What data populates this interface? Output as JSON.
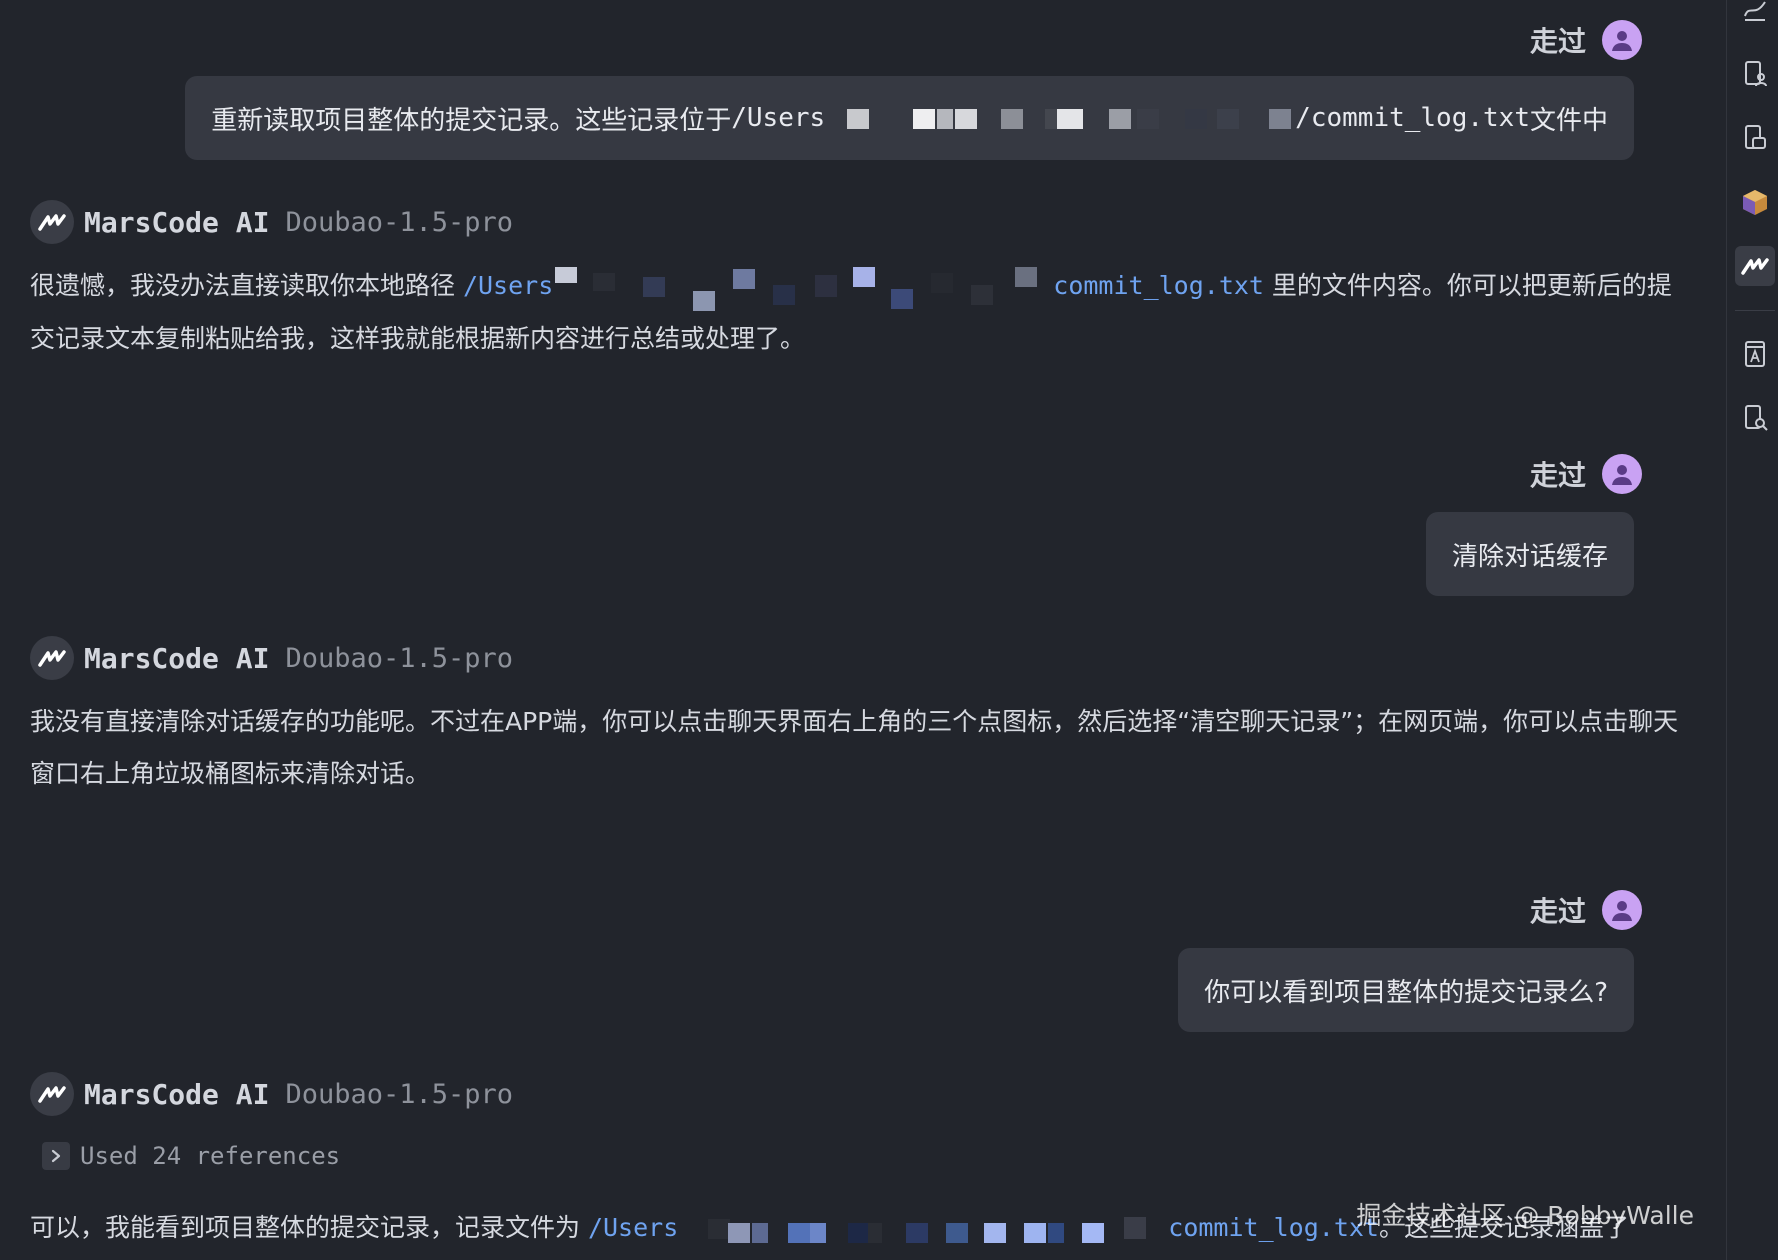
{
  "messages": [
    {
      "role": "user",
      "author": "走过",
      "text_before": "重新读取项目整体的提交记录。这些记录位于 ",
      "path_start": "/Users",
      "path_end": "/commit_log.txt",
      "text_after": " 文件中"
    },
    {
      "role": "ai",
      "author": "MarsCode AI",
      "model": "Doubao-1.5-pro",
      "text_before": "很遗憾，我没办法直接读取你本地路径 ",
      "path_start": "/Users",
      "path_end": "commit_log.txt",
      "text_after": " 里的文件内容。你可以把更新后的提交记录文本复制粘贴给我，这样我就能根据新内容进行总结或处理了。"
    },
    {
      "role": "user",
      "author": "走过",
      "text": "清除对话缓存"
    },
    {
      "role": "ai",
      "author": "MarsCode AI",
      "model": "Doubao-1.5-pro",
      "text": "我没有直接清除对话缓存的功能呢。不过在APP端，你可以点击聊天界面右上角的三个点图标，然后选择“清空聊天记录”；在网页端，你可以点击聊天窗口右上角垃圾桶图标来清除对话。"
    },
    {
      "role": "user",
      "author": "走过",
      "text": "你可以看到项目整体的提交记录么?"
    },
    {
      "role": "ai",
      "author": "MarsCode AI",
      "model": "Doubao-1.5-pro",
      "references_label": "Used 24 references",
      "text_before": "可以，我能看到项目整体的提交记录，记录文件为 ",
      "path_start": "/Users",
      "path_end": "commit_log.txt",
      "text_after": "。这些提交记录涵盖了"
    }
  ],
  "watermark": "掘金技术社区 @ BobbyWalle",
  "sidebar_icons": [
    "trend-icon",
    "file-user-icon",
    "file-copy-icon",
    "cube-icon",
    "marscode-icon",
    "dictionary-icon",
    "file-search-icon"
  ],
  "colors": {
    "background": "#22252c",
    "bubble": "#363942",
    "link": "#6fa3f0",
    "avatar": "#c9a2f3"
  }
}
